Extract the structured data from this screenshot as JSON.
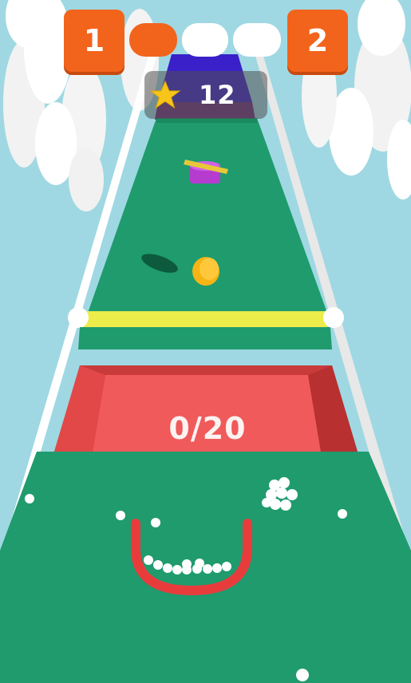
{
  "hud": {
    "level_current": "1",
    "level_next": "2",
    "stage_progress": {
      "segments": 3,
      "completed": 1
    },
    "score": "12",
    "score_icon": "star-icon"
  },
  "gate": {
    "counter": "0/20"
  },
  "colors": {
    "sky": "#9fd8e2",
    "track": "#1f9b6e",
    "level_badge": "#f2641c",
    "rail": "#ffffff",
    "finish_line": "#ecec4a",
    "pit": "#f05a5a",
    "collector": "#e83c3c",
    "coin": "#f6b415",
    "finish_block": "#3a20c8"
  }
}
